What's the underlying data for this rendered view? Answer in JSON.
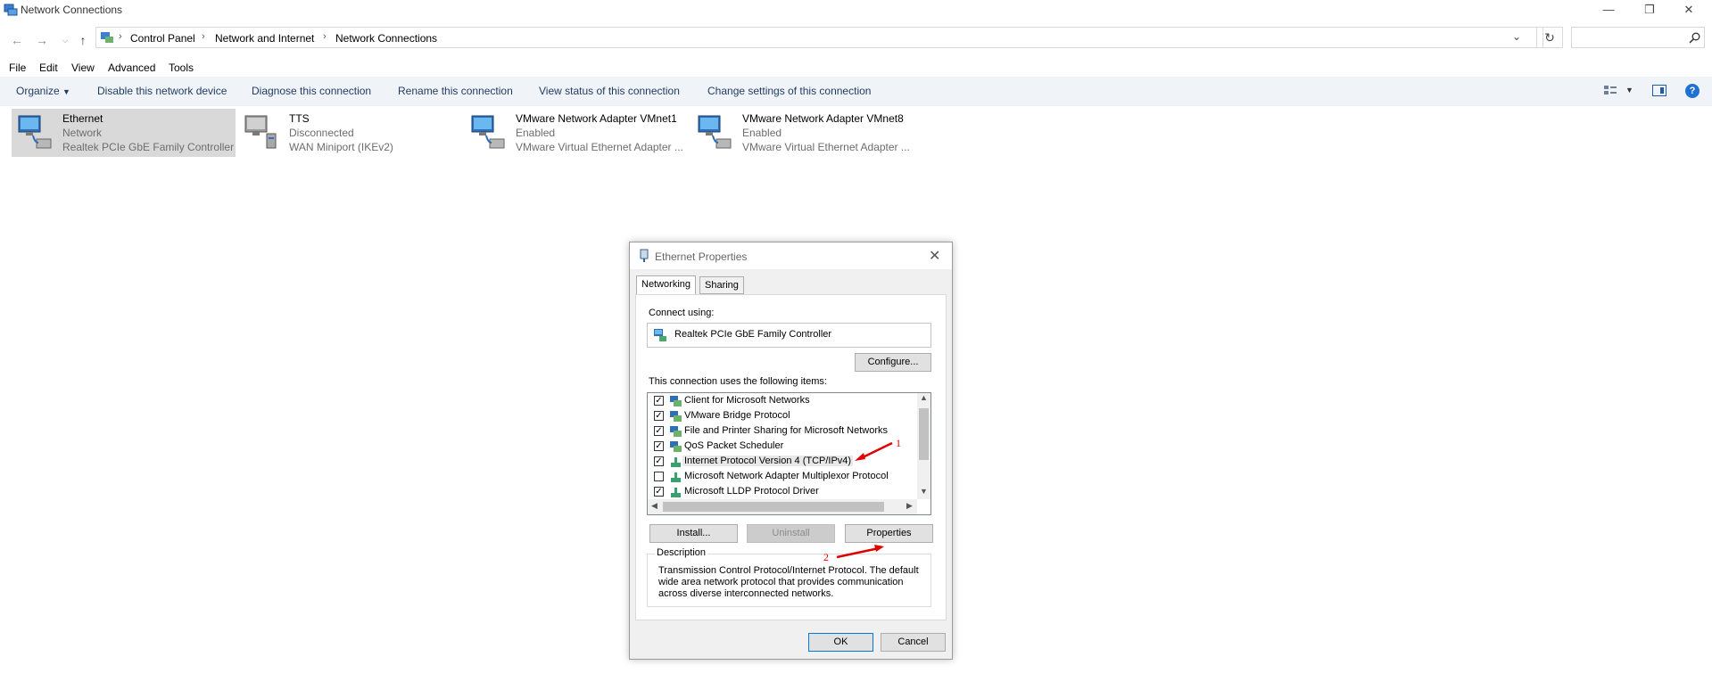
{
  "window": {
    "title": "Network Connections",
    "icon": "network-connections-icon"
  },
  "window_controls": {
    "minimize_icon": "minimize-icon",
    "restore_icon": "restore-icon",
    "close_icon": "close-icon"
  },
  "address_bar": {
    "breadcrumbs": [
      "Control Panel",
      "Network and Internet",
      "Network Connections"
    ],
    "search_placeholder": ""
  },
  "menu": {
    "items": [
      "File",
      "Edit",
      "View",
      "Advanced",
      "Tools"
    ]
  },
  "command_bar": {
    "organize": "Organize",
    "commands": [
      "Disable this network device",
      "Diagnose this connection",
      "Rename this connection",
      "View status of this connection",
      "Change settings of this connection"
    ]
  },
  "connections": [
    {
      "name": "Ethernet",
      "status": "Network",
      "device": "Realtek PCIe GbE Family Controller",
      "selected": true
    },
    {
      "name": "TTS",
      "status": "Disconnected",
      "device": "WAN Miniport (IKEv2)",
      "selected": false
    },
    {
      "name": "VMware Network Adapter VMnet1",
      "status": "Enabled",
      "device": "VMware Virtual Ethernet Adapter ...",
      "selected": false
    },
    {
      "name": "VMware Network Adapter VMnet8",
      "status": "Enabled",
      "device": "VMware Virtual Ethernet Adapter ...",
      "selected": false
    }
  ],
  "dialog": {
    "title": "Ethernet Properties",
    "tabs": [
      "Networking",
      "Sharing"
    ],
    "connect_using_label": "Connect using:",
    "adapter": "Realtek PCIe GbE Family Controller",
    "configure_button": "Configure...",
    "items_label": "This connection uses the following items:",
    "items": [
      {
        "label": "Client for Microsoft Networks",
        "checked": true
      },
      {
        "label": "VMware Bridge Protocol",
        "checked": true
      },
      {
        "label": "File and Printer Sharing for Microsoft Networks",
        "checked": true
      },
      {
        "label": "QoS Packet Scheduler",
        "checked": true
      },
      {
        "label": "Internet Protocol Version 4 (TCP/IPv4)",
        "checked": true,
        "selected": true
      },
      {
        "label": "Microsoft Network Adapter Multiplexor Protocol",
        "checked": false
      },
      {
        "label": "Microsoft LLDP Protocol Driver",
        "checked": true
      }
    ],
    "install_button": "Install...",
    "uninstall_button": "Uninstall",
    "properties_button": "Properties",
    "description_label": "Description",
    "description_text": "Transmission Control Protocol/Internet Protocol. The default wide area network protocol that provides communication across diverse interconnected networks.",
    "ok_button": "OK",
    "cancel_button": "Cancel"
  },
  "annotations": {
    "arrow1_label": "1",
    "arrow2_label": "2",
    "color": "#e00000"
  }
}
